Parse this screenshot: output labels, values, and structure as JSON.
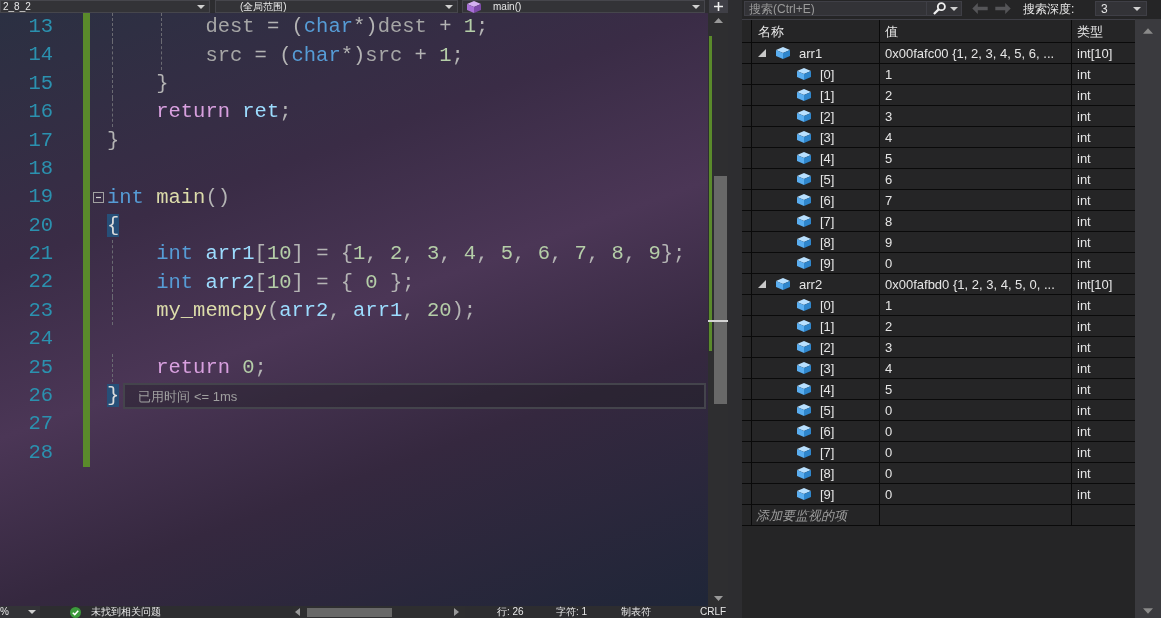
{
  "editor": {
    "navigation": {
      "project": "2_8_2",
      "scope": "(全局范围)",
      "member": "main()"
    },
    "lines": [
      {
        "number": "13",
        "changed": true,
        "collapsible": false,
        "tokens": [
          {
            "kind": "param",
            "text": "        dest"
          },
          {
            "kind": "plain",
            "text": " = ("
          },
          {
            "kind": "keyword",
            "text": "char"
          },
          {
            "kind": "plain",
            "text": "*)"
          },
          {
            "kind": "param",
            "text": "dest"
          },
          {
            "kind": "plain",
            "text": " + "
          },
          {
            "kind": "number",
            "text": "1"
          },
          {
            "kind": "plain",
            "text": ";"
          }
        ]
      },
      {
        "number": "14",
        "changed": true,
        "collapsible": false,
        "tokens": [
          {
            "kind": "param",
            "text": "        src"
          },
          {
            "kind": "plain",
            "text": " = ("
          },
          {
            "kind": "keyword",
            "text": "char"
          },
          {
            "kind": "plain",
            "text": "*)"
          },
          {
            "kind": "param",
            "text": "src"
          },
          {
            "kind": "plain",
            "text": " + "
          },
          {
            "kind": "number",
            "text": "1"
          },
          {
            "kind": "plain",
            "text": ";"
          }
        ]
      },
      {
        "number": "15",
        "changed": true,
        "collapsible": false,
        "tokens": [
          {
            "kind": "plain",
            "text": "    }"
          }
        ]
      },
      {
        "number": "16",
        "changed": true,
        "collapsible": false,
        "tokens": [
          {
            "kind": "control",
            "text": "    return"
          },
          {
            "kind": "local",
            "text": " ret"
          },
          {
            "kind": "plain",
            "text": ";"
          }
        ]
      },
      {
        "number": "17",
        "changed": true,
        "collapsible": false,
        "tokens": [
          {
            "kind": "plain",
            "text": "}"
          }
        ]
      },
      {
        "number": "18",
        "changed": true,
        "collapsible": false
      },
      {
        "number": "19",
        "changed": true,
        "collapsible": true,
        "tokens": [
          {
            "kind": "keyword",
            "text": "int"
          },
          {
            "kind": "function",
            "text": " main"
          },
          {
            "kind": "plain",
            "text": "()"
          }
        ]
      },
      {
        "number": "20",
        "changed": true,
        "collapsible": false,
        "tokens": [
          {
            "kind": "match",
            "text": "{"
          }
        ]
      },
      {
        "number": "21",
        "changed": true,
        "collapsible": false,
        "tokens": [
          {
            "kind": "keyword",
            "text": "    int"
          },
          {
            "kind": "local",
            "text": " arr1"
          },
          {
            "kind": "plain",
            "text": "["
          },
          {
            "kind": "number",
            "text": "10"
          },
          {
            "kind": "plain",
            "text": "] = {"
          },
          {
            "kind": "number",
            "text": "1"
          },
          {
            "kind": "plain",
            "text": ", "
          },
          {
            "kind": "number",
            "text": "2"
          },
          {
            "kind": "plain",
            "text": ", "
          },
          {
            "kind": "number",
            "text": "3"
          },
          {
            "kind": "plain",
            "text": ", "
          },
          {
            "kind": "number",
            "text": "4"
          },
          {
            "kind": "plain",
            "text": ", "
          },
          {
            "kind": "number",
            "text": "5"
          },
          {
            "kind": "plain",
            "text": ", "
          },
          {
            "kind": "number",
            "text": "6"
          },
          {
            "kind": "plain",
            "text": ", "
          },
          {
            "kind": "number",
            "text": "7"
          },
          {
            "kind": "plain",
            "text": ", "
          },
          {
            "kind": "number",
            "text": "8"
          },
          {
            "kind": "plain",
            "text": ", "
          },
          {
            "kind": "number",
            "text": "9"
          },
          {
            "kind": "plain",
            "text": "};"
          }
        ]
      },
      {
        "number": "22",
        "changed": true,
        "collapsible": false,
        "tokens": [
          {
            "kind": "keyword",
            "text": "    int"
          },
          {
            "kind": "local",
            "text": " arr2"
          },
          {
            "kind": "plain",
            "text": "["
          },
          {
            "kind": "number",
            "text": "10"
          },
          {
            "kind": "plain",
            "text": "] = { "
          },
          {
            "kind": "number",
            "text": "0"
          },
          {
            "kind": "plain",
            "text": " };"
          }
        ]
      },
      {
        "number": "23",
        "changed": true,
        "collapsible": false,
        "tokens": [
          {
            "kind": "function",
            "text": "    my_memcpy"
          },
          {
            "kind": "plain",
            "text": "("
          },
          {
            "kind": "local",
            "text": "arr2"
          },
          {
            "kind": "plain",
            "text": ", "
          },
          {
            "kind": "local",
            "text": "arr1"
          },
          {
            "kind": "plain",
            "text": ", "
          },
          {
            "kind": "number",
            "text": "20"
          },
          {
            "kind": "plain",
            "text": ");"
          }
        ]
      },
      {
        "number": "24",
        "changed": true,
        "collapsible": false
      },
      {
        "number": "25",
        "changed": true,
        "collapsible": false,
        "tokens": [
          {
            "kind": "control",
            "text": "    return"
          },
          {
            "kind": "number",
            "text": " 0"
          },
          {
            "kind": "plain",
            "text": ";"
          }
        ]
      },
      {
        "number": "26",
        "changed": true,
        "collapsible": false,
        "tokens": [
          {
            "kind": "match",
            "text": "}"
          }
        ],
        "tip": "已用时间 <= 1ms"
      },
      {
        "number": "27",
        "changed": true,
        "collapsible": false
      },
      {
        "number": "28",
        "changed": true,
        "collapsible": false
      }
    ]
  },
  "status_bar": {
    "zoom": "%",
    "issues": "未找到相关问题",
    "line_position": "行: 26",
    "char_position": "字符: 1",
    "indentation": "制表符",
    "line_ending": "CRLF"
  },
  "watch": {
    "search": {
      "placeholder": "搜索(Ctrl+E)"
    },
    "history_buttons": [
      {
        "kind": "back",
        "disabled": true
      },
      {
        "kind": "forward",
        "disabled": true
      }
    ],
    "depth_label": "搜索深度:",
    "depth": "3",
    "columns": [
      "名称",
      "值",
      "类型"
    ],
    "items": [
      {
        "name": "arr1",
        "value": "0x00fafc00 {1, 2, 3, 4, 5, 6, ...",
        "type": "int[10]",
        "expanded": true,
        "children": [
          {
            "name": "[0]",
            "value": "1",
            "type": "int"
          },
          {
            "name": "[1]",
            "value": "2",
            "type": "int"
          },
          {
            "name": "[2]",
            "value": "3",
            "type": "int"
          },
          {
            "name": "[3]",
            "value": "4",
            "type": "int"
          },
          {
            "name": "[4]",
            "value": "5",
            "type": "int"
          },
          {
            "name": "[5]",
            "value": "6",
            "type": "int"
          },
          {
            "name": "[6]",
            "value": "7",
            "type": "int"
          },
          {
            "name": "[7]",
            "value": "8",
            "type": "int"
          },
          {
            "name": "[8]",
            "value": "9",
            "type": "int"
          },
          {
            "name": "[9]",
            "value": "0",
            "type": "int"
          }
        ]
      },
      {
        "name": "arr2",
        "value": "0x00fafbd0 {1, 2, 3, 4, 5, 0, ...",
        "type": "int[10]",
        "expanded": true,
        "children": [
          {
            "name": "[0]",
            "value": "1",
            "type": "int"
          },
          {
            "name": "[1]",
            "value": "2",
            "type": "int"
          },
          {
            "name": "[2]",
            "value": "3",
            "type": "int"
          },
          {
            "name": "[3]",
            "value": "4",
            "type": "int"
          },
          {
            "name": "[4]",
            "value": "5",
            "type": "int"
          },
          {
            "name": "[5]",
            "value": "0",
            "type": "int"
          },
          {
            "name": "[6]",
            "value": "0",
            "type": "int"
          },
          {
            "name": "[7]",
            "value": "0",
            "type": "int"
          },
          {
            "name": "[8]",
            "value": "0",
            "type": "int"
          },
          {
            "name": "[9]",
            "value": "0",
            "type": "int"
          }
        ]
      }
    ],
    "add_item": {
      "placeholder": "添加要监视的项"
    }
  }
}
